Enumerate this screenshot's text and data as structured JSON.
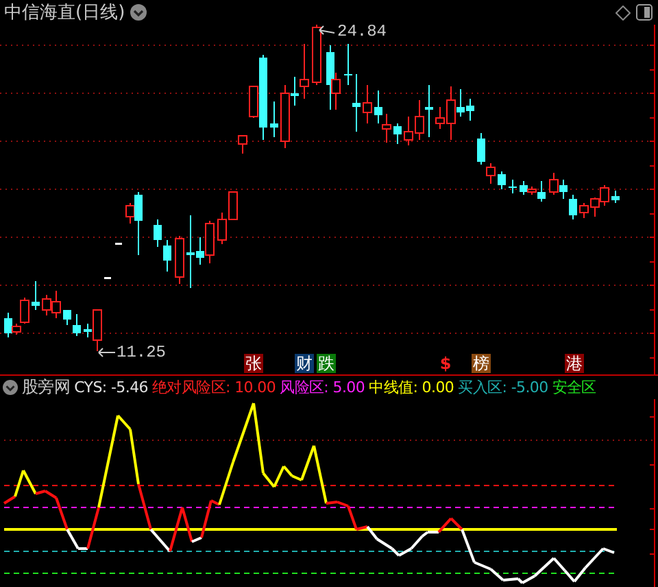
{
  "title": "中信海直(日线)",
  "price_labels": {
    "high": "24.84",
    "low": "11.25"
  },
  "markers": [
    {
      "kind": "tag",
      "label": "张",
      "color": "#8b0000"
    },
    {
      "kind": "tag",
      "label": "财",
      "color": "#0a3a6e"
    },
    {
      "kind": "tag",
      "label": "跌",
      "color": "#0a7a0a"
    },
    {
      "kind": "sign",
      "label": "$",
      "color": "#ff2020"
    },
    {
      "kind": "tag",
      "label": "榜",
      "color": "#8b4a10"
    },
    {
      "kind": "tag",
      "label": "港",
      "color": "#8b0000"
    }
  ],
  "indicator": {
    "name": "股旁网",
    "series": [
      {
        "label": "CYS:",
        "value": "-5.46",
        "color": "#e0e0e0"
      },
      {
        "label": "绝对风险区:",
        "value": "10.00",
        "color": "#ff2020"
      },
      {
        "label": "风险区:",
        "value": "5.00",
        "color": "#ff20ff"
      },
      {
        "label": "中线值:",
        "value": "0.00",
        "color": "#ffff00"
      },
      {
        "label": "买入区:",
        "value": "-5.00",
        "color": "#20b0b0"
      },
      {
        "label": "安全区",
        "color": "#20e020"
      }
    ]
  }
}
